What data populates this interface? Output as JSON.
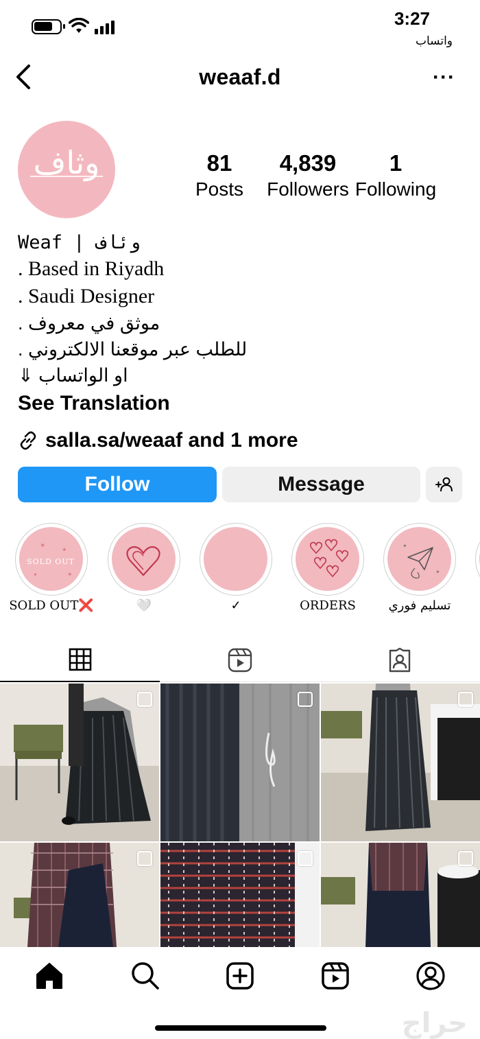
{
  "status_bar": {
    "time": "3:27",
    "back_app": "واتساب"
  },
  "profile": {
    "username": "weaaf.d",
    "stats": {
      "posts": {
        "value": "81",
        "label": "Posts"
      },
      "followers": {
        "value": "4,839",
        "label": "Followers"
      },
      "following": {
        "value": "1",
        "label": "Following"
      }
    },
    "avatar_logo": "وثاف",
    "bio": {
      "name": "Weaf | وئاف",
      "lines": [
        ". Based in Riyadh",
        ". Saudi Designer",
        "موثق في معروف .",
        "للطلب عبر موقعنا الالكتروني .",
        "او الواتساب ⇓"
      ],
      "see_translation": "See Translation"
    },
    "link": "salla.sa/weaaf and 1 more"
  },
  "actions": {
    "follow": "Follow",
    "message": "Message"
  },
  "highlights": [
    {
      "label": "SOLD OUT❌",
      "art": "SOLD OUT"
    },
    {
      "label": "🤍",
      "art": "heart"
    },
    {
      "label": "✓",
      "art": "plain"
    },
    {
      "label": "ORDERS",
      "art": "hearts"
    },
    {
      "label": "تسليم فوري",
      "art": "plane"
    }
  ],
  "tabs": [
    "grid-icon",
    "reels-icon",
    "tagged-icon"
  ],
  "bottom_nav": [
    "home-icon",
    "search-icon",
    "create-icon",
    "reels-icon",
    "profile-icon"
  ],
  "watermark": "حراج",
  "colors": {
    "follow_blue": "#1f97f6",
    "button_gray": "#efefef",
    "highlight_pink": "#f2b9bf"
  }
}
